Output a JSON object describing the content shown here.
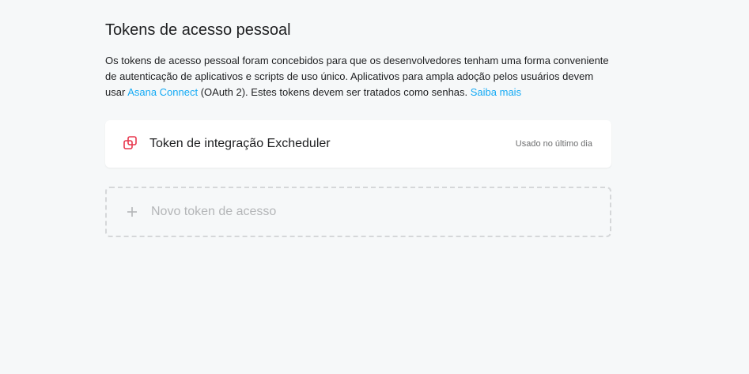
{
  "page": {
    "title": "Tokens de acesso pessoal"
  },
  "description": {
    "part1": "Os tokens de acesso pessoal foram concebidos para que os desenvolvedores tenham uma forma conveniente de autenticação de aplicativos e scripts de uso único. Aplicativos para ampla adoção pelos usuários devem usar ",
    "link_asana_connect": "Asana Connect",
    "part2": " (OAuth 2). Estes tokens devem ser tratados como senhas. ",
    "link_learn_more": "Saiba mais"
  },
  "tokens": [
    {
      "name": "Token de integração Excheduler",
      "status": "Usado no último dia",
      "icon": "key-copy-icon"
    }
  ],
  "new_token": {
    "label": "Novo token de acesso",
    "icon": "plus-icon"
  },
  "colors": {
    "background": "#f6f8f9",
    "link": "#14aaf5",
    "token_icon": "#e8384f",
    "muted_text": "#6d6e6f",
    "placeholder_text": "#b4b6b8",
    "dashed_border": "#d5d7d9"
  }
}
